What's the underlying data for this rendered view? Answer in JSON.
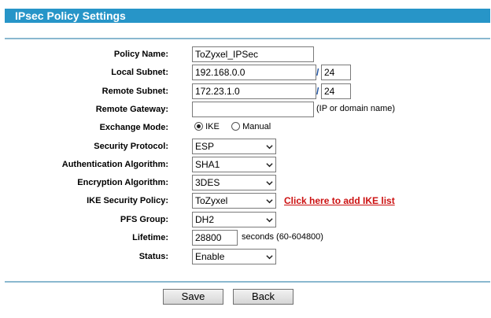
{
  "title": "IPsec Policy Settings",
  "fields": {
    "policy_name": {
      "label": "Policy Name:",
      "value": "ToZyxel_IPSec"
    },
    "local_subnet": {
      "label": "Local Subnet:",
      "value": "192.168.0.0",
      "mask": "24",
      "separator": "/"
    },
    "remote_subnet": {
      "label": "Remote Subnet:",
      "value": "172.23.1.0",
      "mask": "24",
      "separator": "/"
    },
    "remote_gateway": {
      "label": "Remote Gateway:",
      "value": "",
      "hint": "(IP or domain name)"
    },
    "exchange_mode": {
      "label": "Exchange Mode:",
      "options": [
        "IKE",
        "Manual"
      ],
      "selected": "IKE"
    },
    "security_protocol": {
      "label": "Security Protocol:",
      "value": "ESP"
    },
    "auth_algorithm": {
      "label": "Authentication Algorithm:",
      "value": "SHA1"
    },
    "encryption_algorithm": {
      "label": "Encryption Algorithm:",
      "value": "3DES"
    },
    "ike_security_policy": {
      "label": "IKE Security Policy:",
      "value": "ToZyxel",
      "link": "Click here to add IKE list"
    },
    "pfs_group": {
      "label": "PFS Group:",
      "value": "DH2"
    },
    "lifetime": {
      "label": "Lifetime:",
      "value": "28800",
      "hint": "seconds (60-604800)"
    },
    "status": {
      "label": "Status:",
      "value": "Enable"
    }
  },
  "buttons": {
    "save": "Save",
    "back": "Back"
  },
  "colors": {
    "title_bar": "#2795c8",
    "link": "#cc1111",
    "divider": "#8ab8cf"
  }
}
